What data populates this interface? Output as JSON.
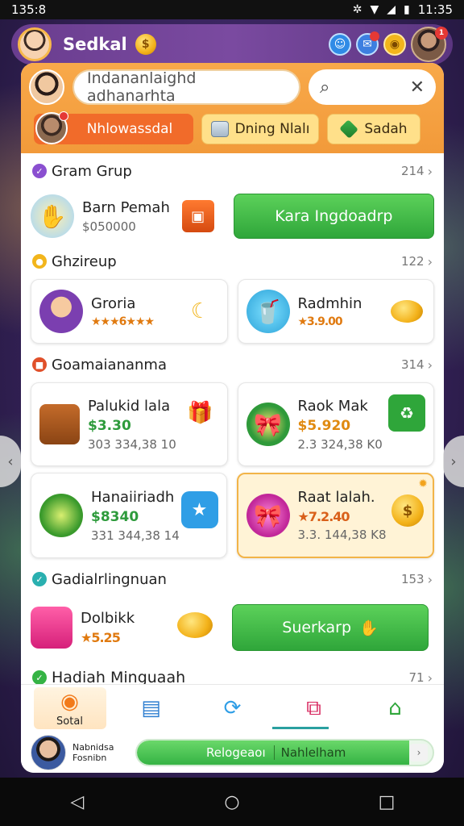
{
  "status_bar": {
    "time": "135:8",
    "right_time": "11:35",
    "icons": [
      "bluetooth-icon",
      "wifi-icon",
      "signal-icon",
      "battery-icon"
    ]
  },
  "top_bar": {
    "username": "Sedkal",
    "notif_badge": "1"
  },
  "header": {
    "search_placeholder": "Indananlaighd adhanarhta",
    "search_icon": "search-icon",
    "close_icon": "close-icon",
    "tabs": [
      {
        "label": "Nhlowassdal",
        "active": true
      },
      {
        "label": "Dning Nlalı",
        "active": false
      },
      {
        "label": "Sadah",
        "active": false
      }
    ]
  },
  "sections": [
    {
      "title": "Gram Grup",
      "count": "214",
      "item": {
        "name": "Barn Pemah",
        "price": "$050000",
        "action": "Kara Ingdoadrp"
      }
    },
    {
      "title": "Ghzireup",
      "count": "122",
      "cards": [
        {
          "name": "Groria",
          "rating": "★★★6★★★"
        },
        {
          "name": "Radmhin",
          "price": "★3.9.00"
        }
      ]
    },
    {
      "title": "Goamaiananma",
      "count": "314",
      "cards": [
        {
          "name": "Palukid lala",
          "price": "$3.30",
          "stock": "303 334,38 10"
        },
        {
          "name": "Raok Mak",
          "price": "$5.920",
          "stock": "2.3 324,38 K0"
        },
        {
          "name": "Hanaiiriadh",
          "price": "$8340",
          "stock": "331 344,38 14"
        },
        {
          "name": "Raat lalah.",
          "price": "★7.2.40",
          "stock": "3.3. 144,38 K8",
          "highlight": true
        }
      ]
    },
    {
      "title": "Gadialrlingnuan",
      "count": "153",
      "item": {
        "name": "Dolbikk",
        "price": "★5.25",
        "action": "Suerkarp"
      }
    },
    {
      "title": "Hadiah Minguaah",
      "count": "71"
    }
  ],
  "bottom_nav": {
    "items": [
      {
        "label": "Sotal",
        "icon": "gift-icon",
        "active": true
      },
      {
        "label": "",
        "icon": "inbox-icon"
      },
      {
        "label": "",
        "icon": "refresh-icon"
      },
      {
        "label": "",
        "icon": "crop-icon"
      },
      {
        "label": "",
        "icon": "home-icon"
      }
    ],
    "profile_name": "Nabnidsa Fosnibn",
    "progress_label_left": "Relogeaoı",
    "progress_label_right": "Nahlelham",
    "progress": 0.92
  },
  "colors": {
    "orange": "#f29a3a",
    "green": "#35b344",
    "purple": "#6a3d8f"
  }
}
